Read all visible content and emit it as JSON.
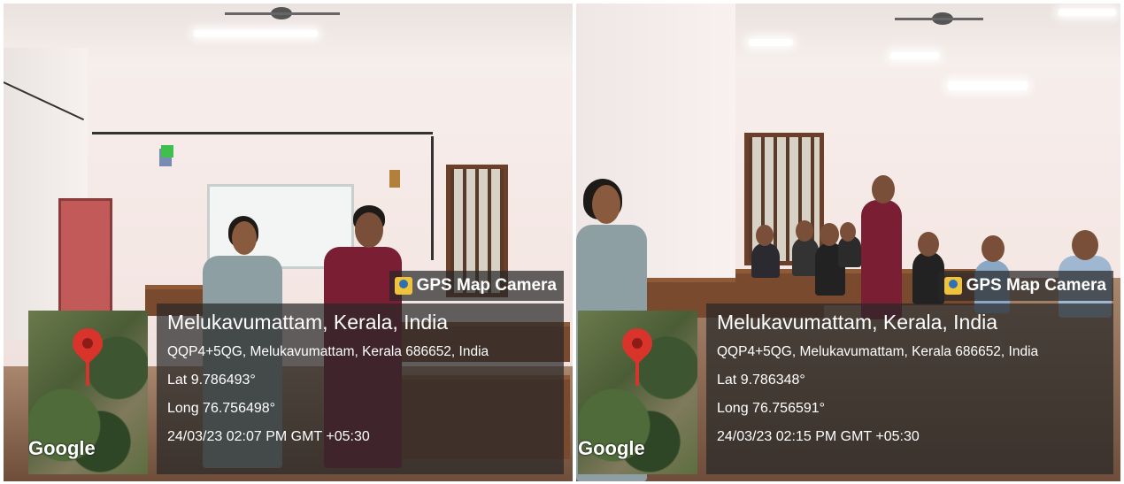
{
  "photos": [
    {
      "badge": "GPS Map Camera",
      "map_logo": "Google",
      "place": "Melukavumattam, Kerala, India",
      "address": "QQP4+5QG, Melukavumattam, Kerala 686652, India",
      "lat": "Lat 9.786493°",
      "long": "Long 76.756498°",
      "timestamp": "24/03/23 02:07 PM GMT +05:30"
    },
    {
      "badge": "GPS Map Camera",
      "map_logo": "Google",
      "place": "Melukavumattam, Kerala, India",
      "address": "QQP4+5QG, Melukavumattam, Kerala 686652, India",
      "lat": "Lat 9.786348°",
      "long": "Long 76.756591°",
      "timestamp": "24/03/23 02:15 PM GMT +05:30"
    }
  ],
  "colors": {
    "overlay": "#282828",
    "pin": "#d9342b",
    "wall": "#f4e6e3"
  }
}
